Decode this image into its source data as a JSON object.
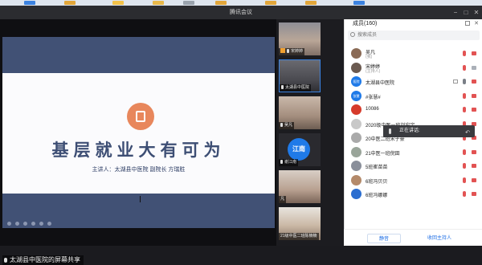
{
  "window": {
    "title": "腾讯会议"
  },
  "share": {
    "slide_title": "基层就业大有可为",
    "speaker_label": "主讲人：",
    "speaker_text": "太湖县中医院  副院长  方瑞胜",
    "sharer_label": "太湖县中医院的屏幕共享"
  },
  "gallery": {
    "tiles": [
      {
        "label": "宋婷婷"
      },
      {
        "label": "太湖县中医院"
      },
      {
        "label": "吴凡"
      },
      {
        "label": "谢江南",
        "avatar_text": "江南",
        "avatar_color": "#1f7ae8"
      },
      {
        "label": "凡"
      },
      {
        "label": "21级中医二班陈楠楠"
      }
    ]
  },
  "panel": {
    "title": "成员(160)",
    "search_placeholder": "搜索成员",
    "members": [
      {
        "name": "吴凡",
        "sub": "(我)",
        "avatar_color": "#8a6a55",
        "mic_on": false,
        "cam_on": false
      },
      {
        "name": "宋婷婷",
        "sub": "(主持人)",
        "avatar_color": "#6b5a50",
        "mic_on": false,
        "cam_on": true
      },
      {
        "name": "太湖县中医院",
        "sub": "",
        "avatar_text": "医院",
        "avatar_color": "#1f7ae8",
        "mic_on": true,
        "cam_on": false,
        "screen": true
      },
      {
        "name": "#张慧#",
        "sub": "",
        "avatar_text": "张慧",
        "avatar_color": "#1f7ae8",
        "mic_on": false,
        "cam_on": false
      },
      {
        "name": "10086",
        "sub": "",
        "avatar_color": "#d63b2b",
        "mic_on": false,
        "cam_on": false
      },
      {
        "name": "2020级中医一班刘宏宇",
        "sub": "",
        "avatar_color": "#c8c8c8",
        "mic_on": false,
        "cam_on": false
      },
      {
        "name": "20中医二班宋子豪",
        "sub": "",
        "avatar_color": "#aaaaaa",
        "mic_on": false,
        "cam_on": false
      },
      {
        "name": "21中医一班倪田",
        "sub": "",
        "avatar_color": "#9aa59a",
        "mic_on": false,
        "cam_on": false
      },
      {
        "name": "5班崔苗苗",
        "sub": "",
        "avatar_color": "#8a8f9a",
        "mic_on": false,
        "cam_on": false
      },
      {
        "name": "6班冯贝贝",
        "sub": "",
        "avatar_color": "#b48a6a",
        "mic_on": false,
        "cam_on": false
      },
      {
        "name": "6班冯娜娜",
        "sub": "",
        "avatar_color": "#2b6ed0",
        "mic_on": false,
        "cam_on": false
      }
    ],
    "speaking_tooltip": "正在讲话:",
    "mute_all_label": "静音",
    "reclaim_host_label": "收回主持人"
  },
  "colors": {
    "accent": "#1f6fe6",
    "slide_blue": "#415175",
    "badge_orange": "#e8875c",
    "muted_red": "#e25353"
  }
}
